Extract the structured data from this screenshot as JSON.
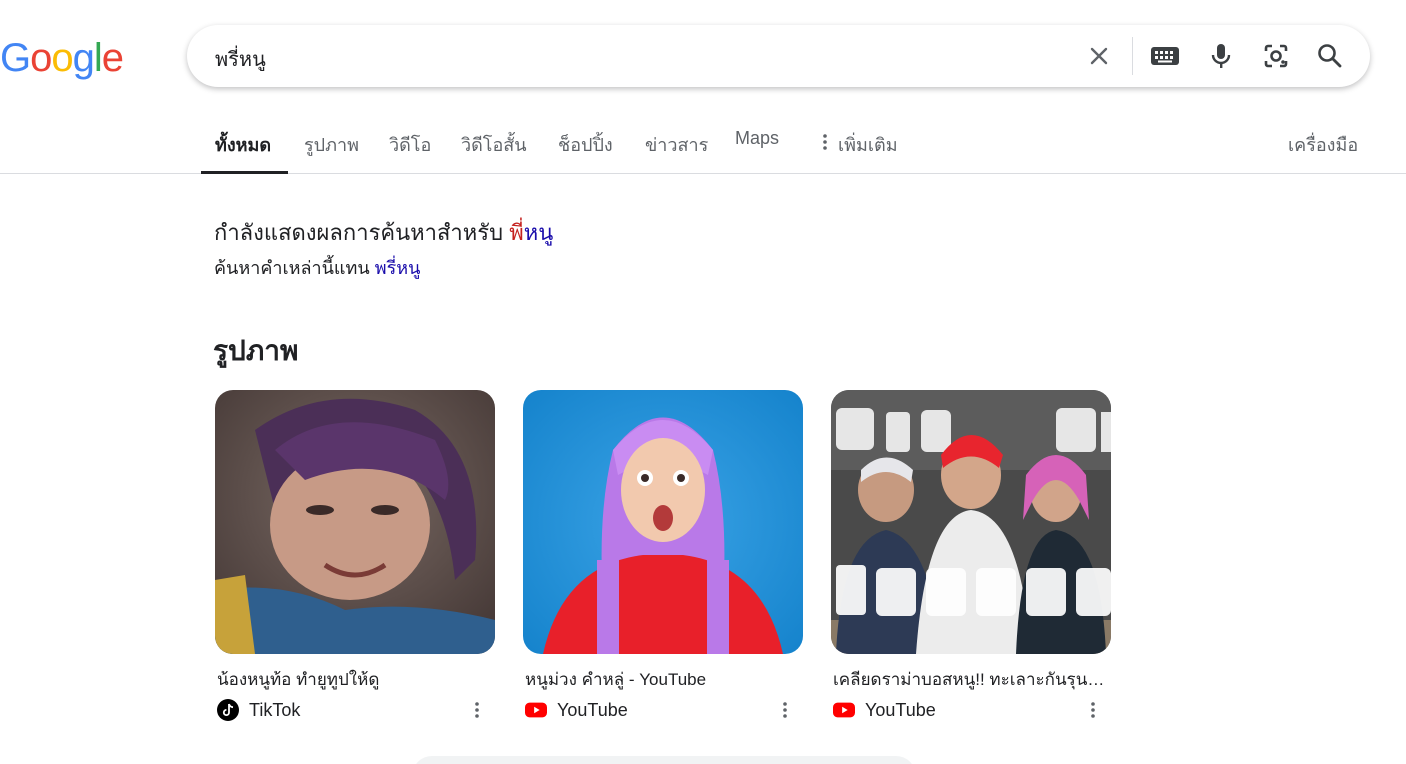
{
  "logo": {
    "letters": [
      "G",
      "o",
      "o",
      "g",
      "l",
      "e"
    ],
    "colors": [
      "#4285f4",
      "#ea4335",
      "#fbbc05",
      "#4285f4",
      "#34a853",
      "#ea4335"
    ]
  },
  "search": {
    "query": "พรี่หนู"
  },
  "tabs": [
    {
      "label": "ทั้งหมด"
    },
    {
      "label": "รูปภาพ"
    },
    {
      "label": "วิดีโอ"
    },
    {
      "label": "วิดีโอสั้น"
    },
    {
      "label": "ช็อปปิ้ง"
    },
    {
      "label": "ข่าวสาร"
    },
    {
      "label": "Maps"
    },
    {
      "label": "เพิ่มเติม"
    }
  ],
  "tools_label": "เครื่องมือ",
  "spell": {
    "showing_prefix": "กำลังแสดงผลการค้นหาสำหรับ",
    "corrected_highlight": "พี่",
    "corrected_rest": "หนู",
    "instead_prefix": "ค้นหาคำเหล่านี้แทน",
    "original": "พรี่หนู"
  },
  "images_section": {
    "title": "รูปภาพ",
    "cards": [
      {
        "caption": "น้องหนูท้อ ทำยูทูปให้ดู",
        "source": "TikTok",
        "source_icon": "tiktok-icon"
      },
      {
        "caption": "หนูม่วง คำหลู่ - YouTube",
        "source": "YouTube",
        "source_icon": "youtube-icon"
      },
      {
        "caption": "เคลียดราม่าบอสหนู!! ทะเลาะกันรุนแรง",
        "source": "YouTube",
        "source_icon": "youtube-icon"
      }
    ]
  },
  "colors": {
    "link": "#1a0dab",
    "highlight": "#c5221f",
    "youtube": "#ff0000"
  }
}
